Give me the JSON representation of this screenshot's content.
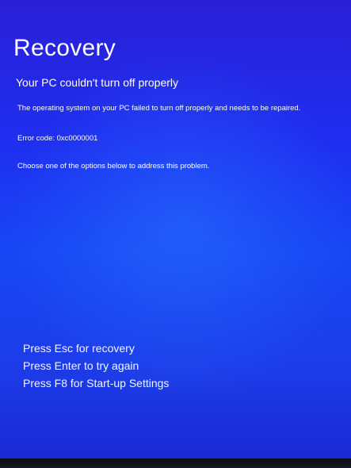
{
  "title": "Recovery",
  "heading": "Your PC couldn't turn off properly",
  "description": "The operating system on your PC failed to turn off properly and needs to be repaired.",
  "error_code": "Error code: 0xc0000001",
  "instruction": "Choose one of the options below to address this problem.",
  "options": [
    "Press Esc for recovery",
    "Press Enter to try again",
    "Press F8 for Start-up Settings"
  ]
}
